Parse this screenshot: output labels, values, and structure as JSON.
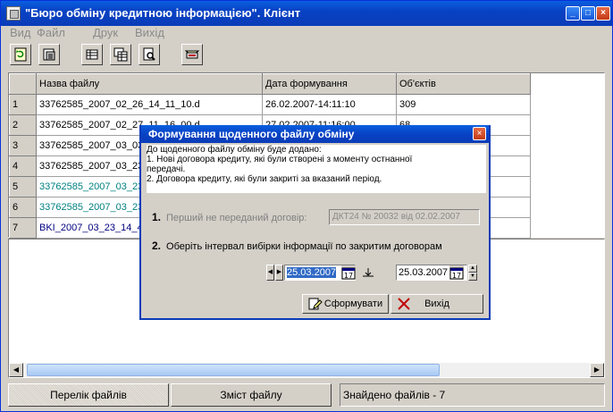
{
  "window": {
    "title": "\"Бюро обміну кредитною інформацією\". Клієнт"
  },
  "menu": [
    "Вид",
    "Файл",
    "Друк",
    "Вихід"
  ],
  "toolbar": {
    "buttons": [
      "refresh-icon",
      "export-icon",
      "table-icon",
      "copy-table-icon",
      "print-preview-icon",
      "send-icon"
    ]
  },
  "grid": {
    "headers": [
      "Назва файлу",
      "Дата формування",
      "Об'єктів"
    ],
    "rows": [
      {
        "n": "1",
        "name": "33762585_2007_02_26_14_11_10.d",
        "date": "26.02.2007-14:11:10",
        "count": "309",
        "color": "#000000"
      },
      {
        "n": "2",
        "name": "33762585_2007_02_27_11_16_00.d",
        "date": "27.02.2007-11:16:00",
        "count": "68",
        "color": "#000000"
      },
      {
        "n": "3",
        "name": "33762585_2007_03_03",
        "date": "",
        "count": "",
        "color": "#000000"
      },
      {
        "n": "4",
        "name": "33762585_2007_03_23",
        "date": "",
        "count": "",
        "color": "#000000"
      },
      {
        "n": "5",
        "name": "33762585_2007_03_23",
        "date": "",
        "count": "",
        "color": "#008080"
      },
      {
        "n": "6",
        "name": "33762585_2007_03_23",
        "date": "",
        "count": "",
        "color": "#008080"
      },
      {
        "n": "7",
        "name": "BKI_2007_03_23_14_4",
        "date": "",
        "count": "",
        "color": "#000080"
      }
    ]
  },
  "status": {
    "tab1": "Перелік файлів",
    "tab2": "Зміст файлу",
    "found": "Знайдено файлів  -  7"
  },
  "dialog": {
    "title": "Формування щоденного файлу обміну",
    "info_line1": "До щоденного файлу обміну буде додано:",
    "info_line2": "  1. Нові договора кредиту, які були створені з моменту остнанної",
    "info_line3": "передачі.",
    "info_line4": "  2. Договора кредиту, які були закриті за вказаний період.",
    "step1_num": "1.",
    "step1_label": "Перший не переданий договір:",
    "step1_value": "ДКТ24 № 20032 від 02.02.2007",
    "step2_num": "2.",
    "step2_label": "Оберіть інтервал вибірки інформації по закритим договорам",
    "date_from": "25.03.2007",
    "date_to": "25.03.2007",
    "btn_generate": "Сформувати",
    "btn_exit": "Вихід"
  }
}
